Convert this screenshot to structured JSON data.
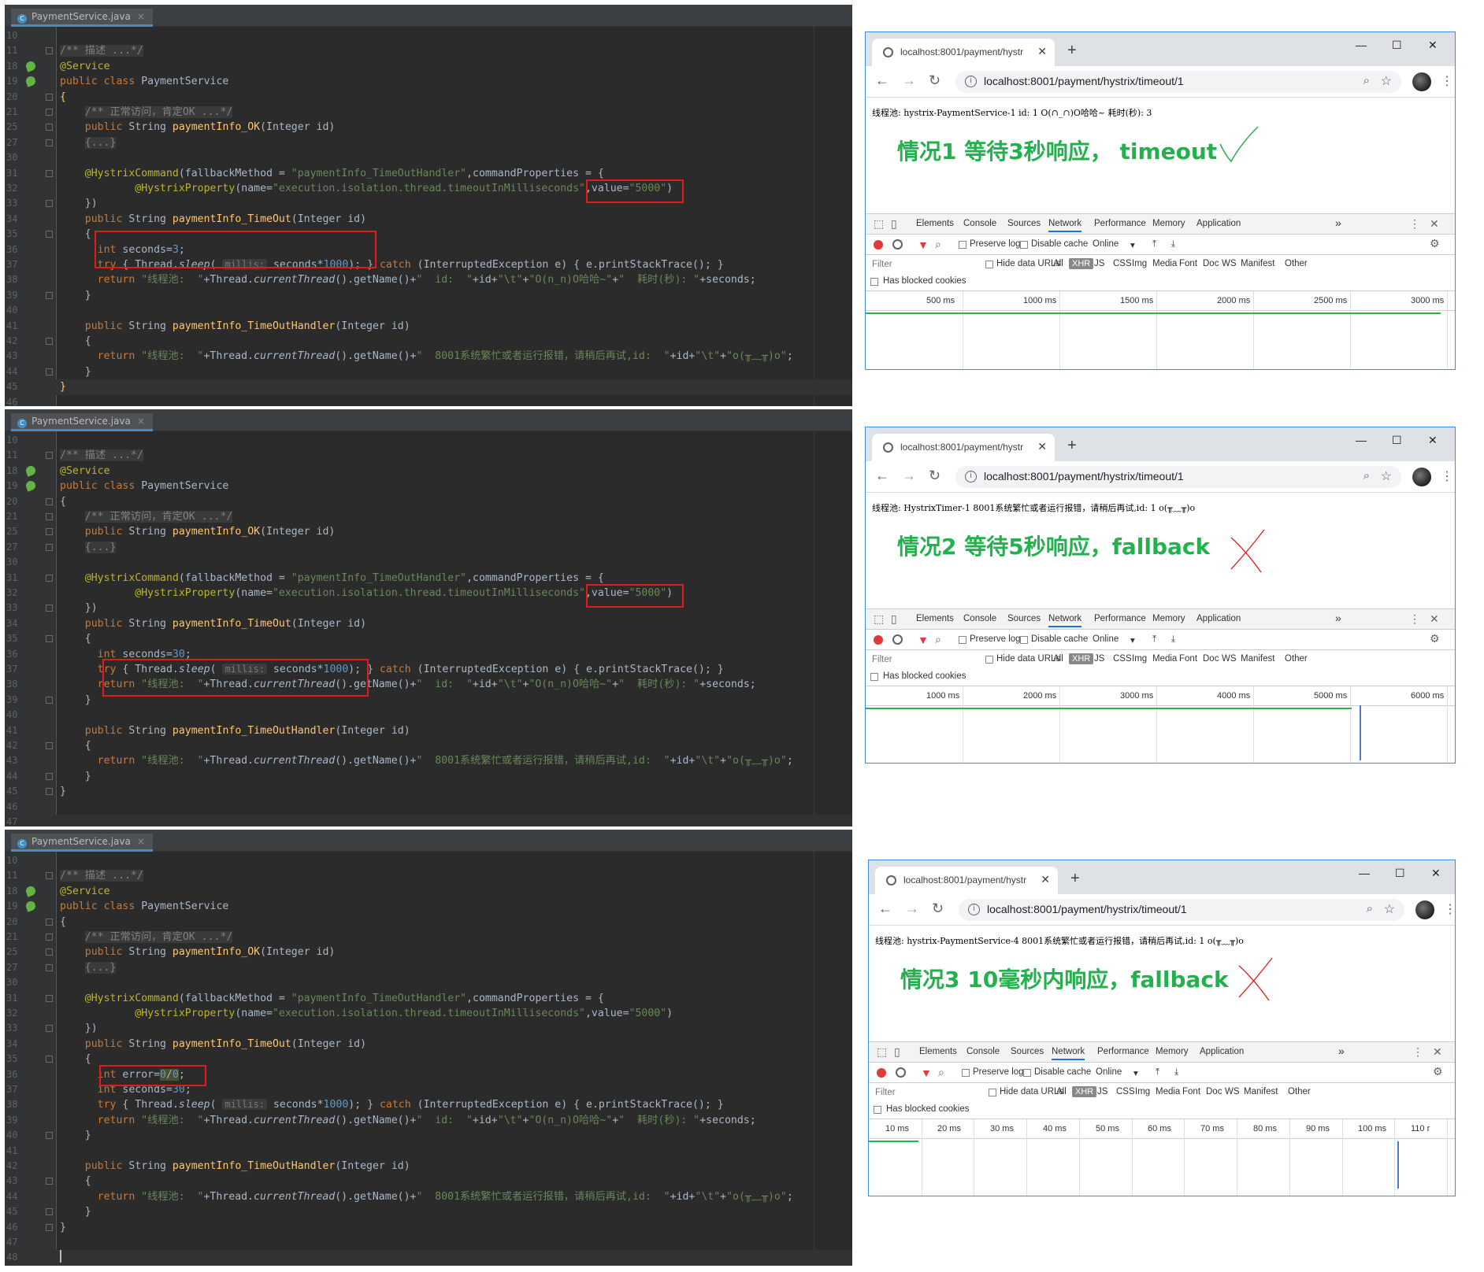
{
  "ide": {
    "tab_name": "PaymentService.java",
    "panels": [
      {
        "lines": [
          {
            "n": "10",
            "html": ""
          },
          {
            "n": "11",
            "html": "<span class=\"cb\">/** 描述 ...*/</span>",
            "fold": true
          },
          {
            "n": "18",
            "html": "<span class=\"a\">@Service</span>",
            "bean": true
          },
          {
            "n": "19",
            "html": "<span class=\"k\">public class </span>PaymentService",
            "bean": true
          },
          {
            "n": "20",
            "html": "<span class=\"f\">{</span>",
            "fold": true
          },
          {
            "n": "21",
            "html": "    <span class=\"cb\">/** 正常访问，肯定OK ...*/</span>",
            "fold": true
          },
          {
            "n": "25",
            "html": "    <span class=\"k\">public </span>String <span class=\"f\">paymentInfo_OK</span>(Integer id)",
            "fold": true
          },
          {
            "n": "27",
            "html": "    <span class=\"cb\">{...}</span>",
            "fold": true
          },
          {
            "n": "30",
            "html": ""
          },
          {
            "n": "31",
            "html": "    <span class=\"a\">@HystrixCommand</span>(fallbackMethod = <span class=\"s\">\"paymentInfo_TimeOutHandler\"</span>,commandProperties = {",
            "fold": true
          },
          {
            "n": "32",
            "html": "            <span class=\"a\">@HystrixProperty</span>(name=<span class=\"s\">\"execution.isolation.thread.timeoutInMilliseconds\"</span>,value=<span class=\"s\">\"5000\"</span>)"
          },
          {
            "n": "33",
            "html": "    })",
            "fold": true
          },
          {
            "n": "34",
            "html": "    <span class=\"k\">public </span>String <span class=\"f\">paymentInfo_TimeOut</span>(Integer id)"
          },
          {
            "n": "35",
            "html": "    {",
            "fold": true
          },
          {
            "n": "36",
            "html": "      <span class=\"k\">int </span>seconds=<span class=\"n\">3</span>;"
          },
          {
            "n": "37",
            "html": "      <span class=\"k\">try </span>{ Thread.<span class=\"i\">sleep</span>( <span class=\"hint\">millis:</span> seconds*<span class=\"n\">1000</span>); } <span class=\"k\">catch </span>(InterruptedException e) { e.printStackTrace(); }"
          },
          {
            "n": "38",
            "html": "      <span class=\"k\">return </span><span class=\"s\">\"线程池:  \"</span>+Thread.<span class=\"i\">currentThread</span>().getName()+<span class=\"s\">\"  id:  \"</span>+id+<span class=\"s\">\"\\t\"</span>+<span class=\"s\">\"O(n_n)O哈哈~\"</span>+<span class=\"s\">\"  耗时(秒): \"</span>+seconds;"
          },
          {
            "n": "39",
            "html": "    }",
            "fold": true
          },
          {
            "n": "40",
            "html": ""
          },
          {
            "n": "41",
            "html": "    <span class=\"k\">public </span>String <span class=\"f\">paymentInfo_TimeOutHandler</span>(Integer id)"
          },
          {
            "n": "42",
            "html": "    {",
            "fold": true
          },
          {
            "n": "43",
            "html": "      <span class=\"k\">return </span><span class=\"s\">\"线程池:  \"</span>+Thread.<span class=\"i\">currentThread</span>().getName()+<span class=\"s\">\"  8001系统繁忙或者运行报错，请稍后再试,id:  \"</span>+id+<span class=\"s\">\"\\t\"</span>+<span class=\"s\">\"o(╥﹏╥)o\"</span>;"
          },
          {
            "n": "44",
            "html": "    }",
            "fold": true
          },
          {
            "n": "45",
            "html": "<span class=\"f\">}</span>",
            "cursor": true
          },
          {
            "n": "46",
            "html": ""
          }
        ]
      },
      {
        "lines": [
          {
            "n": "10",
            "html": ""
          },
          {
            "n": "11",
            "html": "<span class=\"cb\">/** 描述 ...*/</span>",
            "fold": true
          },
          {
            "n": "18",
            "html": "<span class=\"a\">@Service</span>",
            "bean": true
          },
          {
            "n": "19",
            "html": "<span class=\"k\">public class </span>PaymentService",
            "bean": true
          },
          {
            "n": "20",
            "html": "{",
            "fold": true
          },
          {
            "n": "21",
            "html": "    <span class=\"cb\">/** 正常访问，肯定OK ...*/</span>",
            "fold": true
          },
          {
            "n": "25",
            "html": "    <span class=\"k\">public </span>String <span class=\"f\">paymentInfo_OK</span>(Integer id)",
            "fold": true
          },
          {
            "n": "27",
            "html": "    <span class=\"cb\">{...}</span>",
            "fold": true
          },
          {
            "n": "30",
            "html": ""
          },
          {
            "n": "31",
            "html": "    <span class=\"a\">@HystrixCommand</span>(fallbackMethod = <span class=\"s\">\"paymentInfo_TimeOutHandler\"</span>,commandProperties = {",
            "fold": true
          },
          {
            "n": "32",
            "html": "            <span class=\"a\">@HystrixProperty</span>(name=<span class=\"s\">\"execution.isolation.thread.timeoutInMilliseconds\"</span>,value=<span class=\"s\">\"5000\"</span>)"
          },
          {
            "n": "33",
            "html": "    })",
            "fold": true
          },
          {
            "n": "34",
            "html": "    <span class=\"k\">public </span>String <span class=\"f\">paymentInfo_TimeOut</span>(Integer id)"
          },
          {
            "n": "35",
            "html": "    {",
            "fold": true
          },
          {
            "n": "36",
            "html": "      <span class=\"k\">int </span>seconds=<span class=\"n\">30</span>;"
          },
          {
            "n": "37",
            "html": "      <span class=\"k\">try </span>{ Thread.<span class=\"i\">sleep</span>( <span class=\"hint\">millis:</span> seconds*<span class=\"n\">1000</span>); } <span class=\"k\">catch </span>(InterruptedException e) { e.printStackTrace(); }"
          },
          {
            "n": "38",
            "html": "      <span class=\"k\">return </span><span class=\"s\">\"线程池:  \"</span>+Thread.<span class=\"i\">currentThread</span>().getName()+<span class=\"s\">\"  id:  \"</span>+id+<span class=\"s\">\"\\t\"</span>+<span class=\"s\">\"O(n_n)O哈哈~\"</span>+<span class=\"s\">\"  耗时(秒): \"</span>+seconds;"
          },
          {
            "n": "39",
            "html": "    }",
            "fold": true
          },
          {
            "n": "40",
            "html": ""
          },
          {
            "n": "41",
            "html": "    <span class=\"k\">public </span>String <span class=\"f\">paymentInfo_TimeOutHandler</span>(Integer id)"
          },
          {
            "n": "42",
            "html": "    {",
            "fold": true
          },
          {
            "n": "43",
            "html": "      <span class=\"k\">return </span><span class=\"s\">\"线程池:  \"</span>+Thread.<span class=\"i\">currentThread</span>().getName()+<span class=\"s\">\"  8001系统繁忙或者运行报错，请稍后再试,id:  \"</span>+id+<span class=\"s\">\"\\t\"</span>+<span class=\"s\">\"o(╥﹏╥)o\"</span>;"
          },
          {
            "n": "44",
            "html": "    }",
            "fold": true
          },
          {
            "n": "45",
            "html": "}",
            "fold": true
          },
          {
            "n": "46",
            "html": ""
          },
          {
            "n": "47",
            "html": "",
            "cursor": true
          }
        ]
      },
      {
        "lines": [
          {
            "n": "10",
            "html": ""
          },
          {
            "n": "11",
            "html": "<span class=\"cb\">/** 描述 ...*/</span>",
            "fold": true
          },
          {
            "n": "18",
            "html": "<span class=\"a\">@Service</span>",
            "bean": true
          },
          {
            "n": "19",
            "html": "<span class=\"k\">public class </span>PaymentService",
            "bean": true
          },
          {
            "n": "20",
            "html": "{",
            "fold": true
          },
          {
            "n": "21",
            "html": "    <span class=\"cb\">/** 正常访问，肯定OK ...*/</span>",
            "fold": true
          },
          {
            "n": "25",
            "html": "    <span class=\"k\">public </span>String <span class=\"f\">paymentInfo_OK</span>(Integer id)",
            "fold": true
          },
          {
            "n": "27",
            "html": "    <span class=\"cb\">{...}</span>",
            "fold": true
          },
          {
            "n": "30",
            "html": ""
          },
          {
            "n": "31",
            "html": "    <span class=\"a\">@HystrixCommand</span>(fallbackMethod = <span class=\"s\">\"paymentInfo_TimeOutHandler\"</span>,commandProperties = {",
            "fold": true
          },
          {
            "n": "32",
            "html": "            <span class=\"a\">@HystrixProperty</span>(name=<span class=\"s\">\"execution.isolation.thread.timeoutInMilliseconds\"</span>,value=<span class=\"s\">\"5000\"</span>)"
          },
          {
            "n": "33",
            "html": "    })",
            "fold": true
          },
          {
            "n": "34",
            "html": "    <span class=\"k\">public </span>String <span class=\"f\">paymentInfo_TimeOut</span>(Integer id)"
          },
          {
            "n": "35",
            "html": "    {",
            "fold": true
          },
          {
            "n": "36",
            "html": "      <span class=\"k\">int </span>error=<span class=\"hl\"><span class=\"n\">0</span>/<span class=\"n\">0</span></span>;"
          },
          {
            "n": "37",
            "html": "      <span class=\"k\">int </span>seconds=<span class=\"n\">30</span>;"
          },
          {
            "n": "38",
            "html": "      <span class=\"k\">try </span>{ Thread.<span class=\"i\">sleep</span>( <span class=\"hint\">millis:</span> seconds*<span class=\"n\">1000</span>); } <span class=\"k\">catch </span>(InterruptedException e) { e.printStackTrace(); }"
          },
          {
            "n": "39",
            "html": "      <span class=\"k\">return </span><span class=\"s\">\"线程池:  \"</span>+Thread.<span class=\"i\">currentThread</span>().getName()+<span class=\"s\">\"  id:  \"</span>+id+<span class=\"s\">\"\\t\"</span>+<span class=\"s\">\"O(n_n)O哈哈~\"</span>+<span class=\"s\">\"  耗时(秒): \"</span>+seconds;"
          },
          {
            "n": "40",
            "html": "    }",
            "fold": true
          },
          {
            "n": "41",
            "html": ""
          },
          {
            "n": "42",
            "html": "    <span class=\"k\">public </span>String <span class=\"f\">paymentInfo_TimeOutHandler</span>(Integer id)"
          },
          {
            "n": "43",
            "html": "    {",
            "fold": true
          },
          {
            "n": "44",
            "html": "      <span class=\"k\">return </span><span class=\"s\">\"线程池:  \"</span>+Thread.<span class=\"i\">currentThread</span>().getName()+<span class=\"s\">\"  8001系统繁忙或者运行报错，请稍后再试,id:  \"</span>+id+<span class=\"s\">\"\\t\"</span>+<span class=\"s\">\"o(╥﹏╥)o\"</span>;"
          },
          {
            "n": "45",
            "html": "    }",
            "fold": true
          },
          {
            "n": "46",
            "html": "}",
            "fold": true
          },
          {
            "n": "47",
            "html": ""
          },
          {
            "n": "48",
            "html": "<span class=\"caret\"></span>",
            "cursor": true
          }
        ]
      }
    ]
  },
  "browser": {
    "tab_title": "localhost:8001/payment/hystr",
    "url": "localhost:8001/payment/hystrix/timeout/1",
    "new_tab": "+",
    "devtools_tabs": [
      "Elements",
      "Console",
      "Sources",
      "Network",
      "Performance",
      "Memory",
      "Application"
    ],
    "active_tab": "Network",
    "more_tabs": "»",
    "preserve_log": "Preserve log",
    "disable_cache": "Disable cache",
    "throttle": "Online",
    "filter_placeholder": "Filter",
    "hide_data_urls": "Hide data URLs",
    "types": [
      "All",
      "XHR",
      "JS",
      "CSS",
      "Img",
      "Media",
      "Font",
      "Doc",
      "WS",
      "Manifest",
      "Other"
    ],
    "has_blocked": "Has blocked cookies",
    "panels": [
      {
        "response": "线程池:  hystrix-PaymentService-1 id:  1       O(∩_∩)O哈哈~  耗时(秒): 3",
        "note": "情况1 等待3秒响应， timeout",
        "mark": "check",
        "ticks": [
          "500 ms",
          "1000 ms",
          "1500 ms",
          "2000 ms",
          "2500 ms",
          "3000 ms"
        ]
      },
      {
        "response": "线程池:  HystrixTimer-1  8001系统繁忙或者运行报错，请稍后再试,id:  1    o(╥﹏╥)o",
        "note": "情况2 等待5秒响应，fallback",
        "mark": "cross",
        "ticks": [
          "1000 ms",
          "2000 ms",
          "3000 ms",
          "4000 ms",
          "5000 ms",
          "6000 ms"
        ]
      },
      {
        "response": "线程池:  hystrix-PaymentService-4  8001系统繁忙或者运行报错，请稍后再试,id:  1   o(╥﹏╥)o",
        "note": "情况3 10毫秒内响应，fallback",
        "mark": "cross",
        "ticks": [
          "10 ms",
          "20 ms",
          "30 ms",
          "40 ms",
          "50 ms",
          "60 ms",
          "70 ms",
          "80 ms",
          "90 ms",
          "100 ms",
          "110 r"
        ]
      }
    ]
  }
}
